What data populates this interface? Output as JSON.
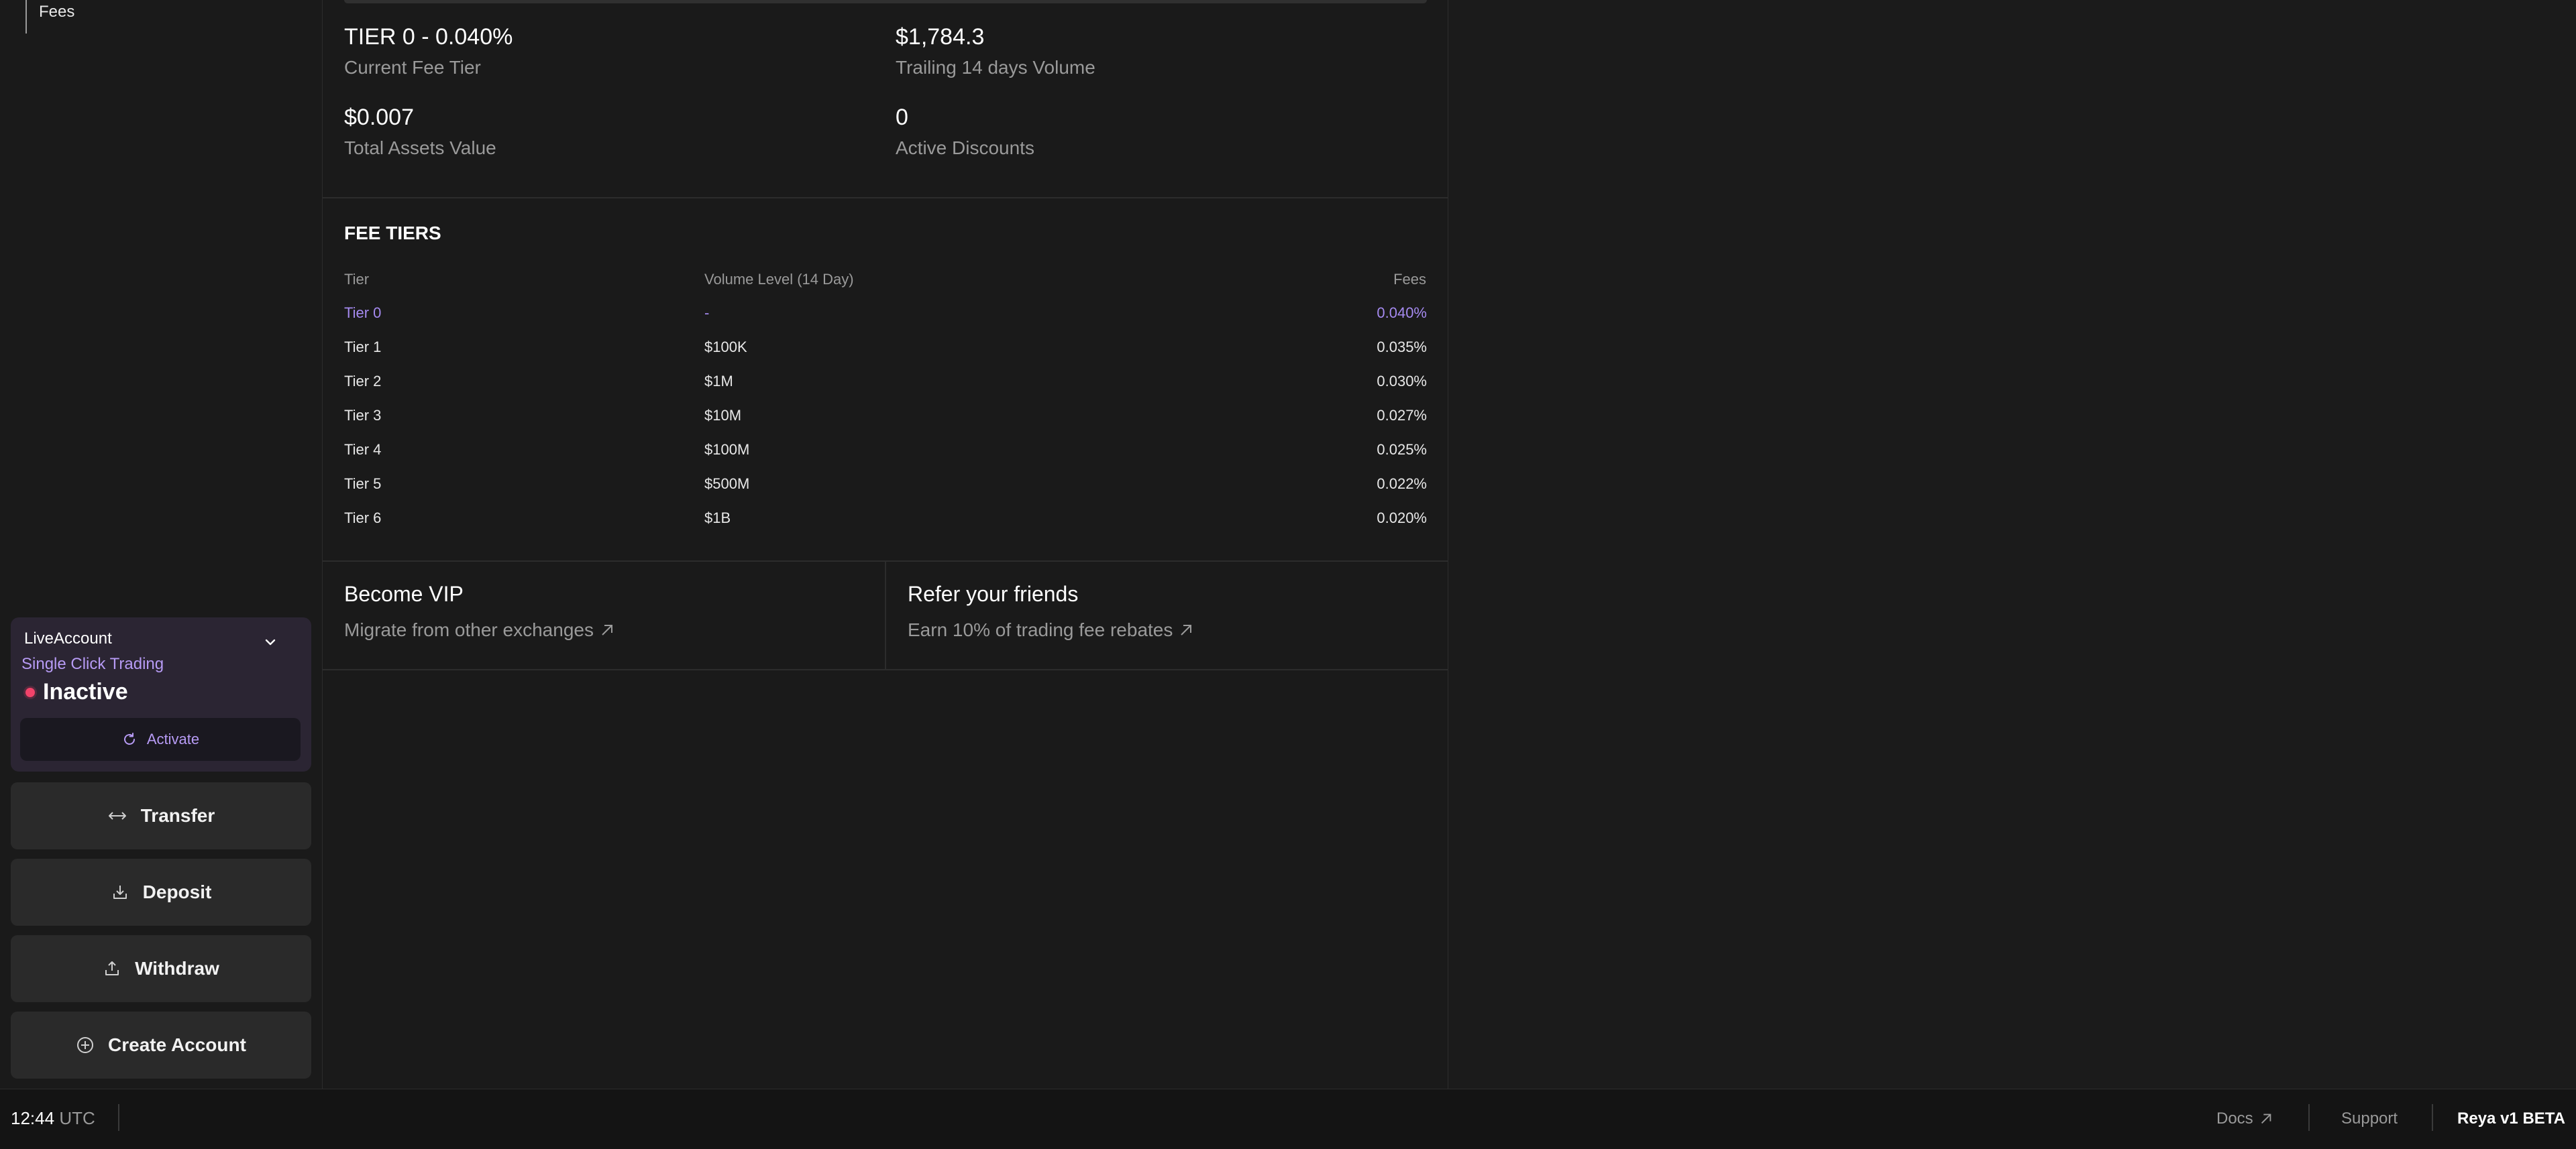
{
  "sidebar": {
    "nav_items": [
      {
        "label": "Fees"
      }
    ],
    "account": {
      "name": "LiveAccount",
      "subtitle": "Single Click Trading",
      "status": "Inactive",
      "activate_label": "Activate"
    },
    "buttons": [
      {
        "label": "Transfer",
        "icon": "transfer-arrows-icon"
      },
      {
        "label": "Deposit",
        "icon": "download-icon"
      },
      {
        "label": "Withdraw",
        "icon": "upload-icon"
      },
      {
        "label": "Create Account",
        "icon": "plus-circle-icon"
      }
    ]
  },
  "stats": {
    "tier": {
      "value": "TIER 0 - 0.040%",
      "label": "Current Fee Tier"
    },
    "volume": {
      "value": "$1,784.3",
      "label": "Trailing 14 days Volume"
    },
    "assets": {
      "value": "$0.007",
      "label": "Total Assets Value"
    },
    "discounts": {
      "value": "0",
      "label": "Active Discounts"
    }
  },
  "fee_tiers": {
    "title": "FEE TIERS",
    "headers": {
      "tier": "Tier",
      "volume": "Volume Level (14 Day)",
      "fees": "Fees"
    },
    "rows": [
      {
        "tier": "Tier 0",
        "volume": "-",
        "fees": "0.040%"
      },
      {
        "tier": "Tier 1",
        "volume": "$100K",
        "fees": "0.035%"
      },
      {
        "tier": "Tier 2",
        "volume": "$1M",
        "fees": "0.030%"
      },
      {
        "tier": "Tier 3",
        "volume": "$10M",
        "fees": "0.027%"
      },
      {
        "tier": "Tier 4",
        "volume": "$100M",
        "fees": "0.025%"
      },
      {
        "tier": "Tier 5",
        "volume": "$500M",
        "fees": "0.022%"
      },
      {
        "tier": "Tier 6",
        "volume": "$1B",
        "fees": "0.020%"
      }
    ]
  },
  "promos": {
    "vip": {
      "title": "Become VIP",
      "subtitle": "Migrate from other exchanges"
    },
    "refer": {
      "title": "Refer your friends",
      "subtitle": "Earn 10% of trading fee rebates"
    }
  },
  "footer": {
    "time": "12:44",
    "timezone": "UTC",
    "docs": "Docs",
    "support": "Support",
    "version": "Reya v1 BETA"
  },
  "colors": {
    "accent": "#b79bf5",
    "status_inactive": "#f0436a",
    "background": "#1a1a1a"
  }
}
